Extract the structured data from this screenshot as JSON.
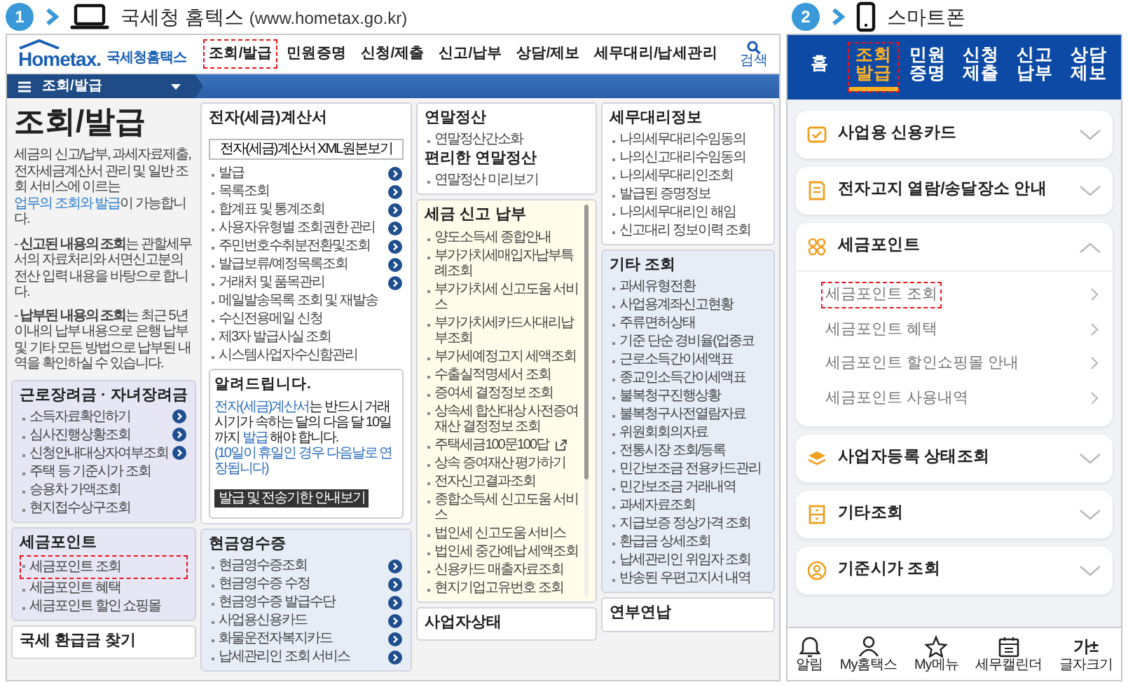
{
  "pc_header": {
    "step": "1",
    "title": "국세청 홈텍스",
    "url": "(www.hometax.go.kr)"
  },
  "mobile_header": {
    "step": "2",
    "title": "스마트폰"
  },
  "hometax": {
    "logo": {
      "wordmark": "Hometax.",
      "name": "국세청홈택스"
    },
    "menu": [
      {
        "label": "조회/발급",
        "highlighted": true
      },
      {
        "label": "민원증명",
        "highlighted": false
      },
      {
        "label": "신청/제출",
        "highlighted": false
      },
      {
        "label": "신고/납부",
        "highlighted": false
      },
      {
        "label": "상담/제보",
        "highlighted": false
      },
      {
        "label": "세무대리/납세관리",
        "highlighted": false
      }
    ],
    "search_label": "검색",
    "breadcrumb": "조회/발급",
    "intro": {
      "title": "조회/발급",
      "description": {
        "before": "세금의 신고/납부, 과세자료제출, 전자세금계산서 관리 및 일반 조회 서비스에 이르는 ",
        "link": "업무의 조회와 발급",
        "after": "이 가능합니다."
      },
      "notes": [
        "- **신고된 내용의 조회**는 관할세무서의 자료처리와 서면신고분의 전산 입력 내용을 바탕으로 합니다.",
        "- **납부된 내용의 조회**는 최근 5년 이내의 납부 내용으로 은행 납부 및 기타 모든 방법으로 납부된 내역을 확인하실 수 있습니다."
      ]
    },
    "columns": [
      {
        "panels": [
          {
            "color": "#e6e6f5",
            "scrollbar": false,
            "blocks": [
              {
                "kind": "heading",
                "text": "근로장려금 · 자녀장려금"
              },
              {
                "kind": "link",
                "text": "소득자료확인하기",
                "arrow": true,
                "highlighted": false
              },
              {
                "kind": "link",
                "text": "심사진행상황조회",
                "arrow": true,
                "highlighted": false
              },
              {
                "kind": "link",
                "text": "신청안내대상자여부조회",
                "arrow": true,
                "highlighted": false
              },
              {
                "kind": "link",
                "text": "주택 등 기준시가 조회",
                "arrow": false,
                "highlighted": false
              },
              {
                "kind": "link",
                "text": "승용차 가액조회",
                "arrow": false,
                "highlighted": false
              },
              {
                "kind": "link",
                "text": "현지접수상구조회",
                "arrow": false,
                "highlighted": false
              }
            ]
          },
          {
            "color": "#e6e6f5",
            "scrollbar": false,
            "blocks": [
              {
                "kind": "heading",
                "text": "세금포인트"
              },
              {
                "kind": "link",
                "text": "세금포인트 조회",
                "arrow": false,
                "highlighted": true
              },
              {
                "kind": "link",
                "text": "세금포인트 혜택",
                "arrow": false,
                "highlighted": false
              },
              {
                "kind": "link",
                "text": "세금포인트 할인 쇼핑몰",
                "arrow": false,
                "highlighted": false
              }
            ]
          },
          {
            "color": "#ffffff",
            "scrollbar": false,
            "blocks": [
              {
                "kind": "heading",
                "text": "국세 환급금 찾기"
              }
            ]
          }
        ]
      },
      {
        "panels": [
          {
            "color": "#ffffff",
            "scrollbar": false,
            "blocks": [
              {
                "kind": "heading",
                "text": "전자(세금)계산서"
              },
              {
                "kind": "button",
                "text": "전자(세금)계산서 XML원본보기"
              },
              {
                "kind": "link",
                "text": "발급",
                "arrow": true,
                "highlighted": false
              },
              {
                "kind": "link",
                "text": "목록조회",
                "arrow": true,
                "highlighted": false
              },
              {
                "kind": "link",
                "text": "합계표 및 통계조회",
                "arrow": true,
                "highlighted": false
              },
              {
                "kind": "link",
                "text": "사용자유형별 조회권한 관리",
                "arrow": true,
                "highlighted": false
              },
              {
                "kind": "link",
                "text": "주민번호수취분전환및조회",
                "arrow": true,
                "highlighted": false
              },
              {
                "kind": "link",
                "text": "발급보류/예정목록조회",
                "arrow": true,
                "highlighted": false
              },
              {
                "kind": "link",
                "text": "거래처 및 품목관리",
                "arrow": true,
                "highlighted": false
              },
              {
                "kind": "link",
                "text": "메일발송목록 조회 및 재발송",
                "arrow": false,
                "highlighted": false
              },
              {
                "kind": "link",
                "text": "수신전용메일 신청",
                "arrow": false,
                "highlighted": false
              },
              {
                "kind": "link",
                "text": "제3자 발급사실 조회",
                "arrow": false,
                "highlighted": false
              },
              {
                "kind": "link",
                "text": "시스템사업자수신함관리",
                "arrow": false,
                "highlighted": false
              },
              {
                "kind": "notice",
                "title": "알려드립니다.",
                "message": [
                  {
                    "text": "전자(세금)계산서",
                    "emphasis": true
                  },
                  {
                    "text": "는 반드시 거래시기가 속하는 달의 다음 달 10일까지 ",
                    "emphasis": false
                  },
                  {
                    "text": "발급",
                    "emphasis": true
                  },
                  {
                    "text": " 해야 합니다.",
                    "emphasis": false
                  }
                ],
                "remark": "(10일이 휴일인 경우 다음날로 연장됩니다)",
                "button": "발급 및 전송기한 안내보기"
              }
            ]
          },
          {
            "color": "#e6edf6",
            "scrollbar": false,
            "blocks": [
              {
                "kind": "heading",
                "text": "현금영수증"
              },
              {
                "kind": "link",
                "text": "현금영수증조회",
                "arrow": true,
                "highlighted": false
              },
              {
                "kind": "link",
                "text": "현금영수증 수정",
                "arrow": true,
                "highlighted": false
              },
              {
                "kind": "link",
                "text": "현금영수증 발급수단",
                "arrow": true,
                "highlighted": false
              },
              {
                "kind": "link",
                "text": "사업용신용카드",
                "arrow": true,
                "highlighted": false
              },
              {
                "kind": "link",
                "text": "화물운전자복지카드",
                "arrow": true,
                "highlighted": false
              },
              {
                "kind": "link",
                "text": "납세관리인 조회 서비스",
                "arrow": true,
                "highlighted": false
              }
            ]
          }
        ]
      },
      {
        "panels": [
          {
            "color": "#ffffff",
            "scrollbar": false,
            "blocks": [
              {
                "kind": "heading",
                "text": "연말정산"
              },
              {
                "kind": "link",
                "text": "연말정산간소화",
                "arrow": false,
                "highlighted": false
              },
              {
                "kind": "heading",
                "text": "편리한 연말정산"
              },
              {
                "kind": "link",
                "text": "연말정산 미리보기",
                "arrow": false,
                "highlighted": false
              }
            ]
          },
          {
            "color": "#fffdea",
            "scrollbar": true,
            "blocks": [
              {
                "kind": "heading",
                "text": "세금 신고 납부"
              },
              {
                "kind": "link",
                "text": "양도소득세 종합안내",
                "arrow": false,
                "highlighted": false
              },
              {
                "kind": "link",
                "text": "부가가치세매입자납부특례조회",
                "arrow": false,
                "highlighted": false
              },
              {
                "kind": "link",
                "text": "부가가치세 신고도움 서비스",
                "arrow": false,
                "highlighted": false
              },
              {
                "kind": "link",
                "text": "부가가치세카드사대리납부조회",
                "arrow": false,
                "highlighted": false
              },
              {
                "kind": "link",
                "text": "부가세예정고지 세액조회",
                "arrow": false,
                "highlighted": false
              },
              {
                "kind": "link",
                "text": "수출실적명세서 조회",
                "arrow": false,
                "highlighted": false
              },
              {
                "kind": "link",
                "text": "증여세 결정정보 조회",
                "arrow": false,
                "highlighted": false
              },
              {
                "kind": "link",
                "text": "상속세 합산대상 사전증여재산 결정정보 조회",
                "arrow": false,
                "highlighted": false
              },
              {
                "kind": "link",
                "text": "주택세금100문100답",
                "arrow": false,
                "highlighted": false,
                "external": true
              },
              {
                "kind": "link",
                "text": "상속 증여재산 평가하기",
                "arrow": false,
                "highlighted": false
              },
              {
                "kind": "link",
                "text": "전자신고결과조회",
                "arrow": false,
                "highlighted": false
              },
              {
                "kind": "link",
                "text": "종합소득세 신고도움 서비스",
                "arrow": false,
                "highlighted": false
              },
              {
                "kind": "link",
                "text": "법인세 신고도움 서비스",
                "arrow": false,
                "highlighted": false
              },
              {
                "kind": "link",
                "text": "법인세 중간예납 세액조회",
                "arrow": false,
                "highlighted": false
              },
              {
                "kind": "link",
                "text": "신용카드 매출자료조회",
                "arrow": false,
                "highlighted": false
              },
              {
                "kind": "link",
                "text": "현지기업고유번호 조회",
                "arrow": false,
                "highlighted": false
              }
            ]
          },
          {
            "color": "#ffffff",
            "scrollbar": false,
            "blocks": [
              {
                "kind": "heading",
                "text": "사업자상태"
              }
            ]
          }
        ]
      },
      {
        "panels": [
          {
            "color": "#ffffff",
            "scrollbar": false,
            "blocks": [
              {
                "kind": "heading",
                "text": "세무대리정보"
              },
              {
                "kind": "link",
                "text": "나의세무대리수임동의",
                "arrow": false,
                "highlighted": false
              },
              {
                "kind": "link",
                "text": "나의신고대리수임동의",
                "arrow": false,
                "highlighted": false
              },
              {
                "kind": "link",
                "text": "나의세무대리인조회",
                "arrow": false,
                "highlighted": false
              },
              {
                "kind": "link",
                "text": "발급된 증명정보",
                "arrow": false,
                "highlighted": false
              },
              {
                "kind": "link",
                "text": "나의세무대리인 해임",
                "arrow": false,
                "highlighted": false
              },
              {
                "kind": "link",
                "text": "신고대리 정보이력 조회",
                "arrow": false,
                "highlighted": false
              }
            ]
          },
          {
            "color": "#e6edf6",
            "scrollbar": false,
            "blocks": [
              {
                "kind": "heading",
                "text": "기타 조회"
              },
              {
                "kind": "link",
                "text": "과세유형전환",
                "arrow": false,
                "highlighted": false
              },
              {
                "kind": "link",
                "text": "사업용계좌신고현황",
                "arrow": false,
                "highlighted": false
              },
              {
                "kind": "link",
                "text": "주류면허상태",
                "arrow": false,
                "highlighted": false
              },
              {
                "kind": "link",
                "text": "기준 단순 경비율(업종코",
                "arrow": false,
                "highlighted": false
              },
              {
                "kind": "link",
                "text": "근로소득간이세액표",
                "arrow": false,
                "highlighted": false
              },
              {
                "kind": "link",
                "text": "종교인소득간이세액표",
                "arrow": false,
                "highlighted": false
              },
              {
                "kind": "link",
                "text": "불복청구진행상황",
                "arrow": false,
                "highlighted": false
              },
              {
                "kind": "link",
                "text": "불복청구사전열람자료",
                "arrow": false,
                "highlighted": false
              },
              {
                "kind": "link",
                "text": "위원회회의자료",
                "arrow": false,
                "highlighted": false
              },
              {
                "kind": "link",
                "text": "전통시장 조회/등록",
                "arrow": false,
                "highlighted": false
              },
              {
                "kind": "link",
                "text": "민간보조금 전용카드관리",
                "arrow": false,
                "highlighted": false
              },
              {
                "kind": "link",
                "text": "민간보조금 거래내역",
                "arrow": false,
                "highlighted": false
              },
              {
                "kind": "link",
                "text": "과세자료조회",
                "arrow": false,
                "highlighted": false
              },
              {
                "kind": "link",
                "text": "지급보증 정상가격 조회",
                "arrow": false,
                "highlighted": false
              },
              {
                "kind": "link",
                "text": "환급금 상세조회",
                "arrow": false,
                "highlighted": false
              },
              {
                "kind": "link",
                "text": "납세관리인 위임자 조회",
                "arrow": false,
                "highlighted": false
              },
              {
                "kind": "link",
                "text": "반송된 우편고지서 내역",
                "arrow": false,
                "highlighted": false
              }
            ]
          },
          {
            "color": "#ffffff",
            "scrollbar": false,
            "blocks": [
              {
                "kind": "heading",
                "text": "연부연납"
              }
            ]
          }
        ]
      }
    ]
  },
  "mobile": {
    "tabs": [
      {
        "label": "홈",
        "selected": false,
        "highlighted": false
      },
      {
        "label": "조회 발급",
        "selected": true,
        "highlighted": true
      },
      {
        "label": "민원 증명",
        "selected": false,
        "highlighted": false
      },
      {
        "label": "신청 제출",
        "selected": false,
        "highlighted": false
      },
      {
        "label": "신고 납부",
        "selected": false,
        "highlighted": false
      },
      {
        "label": "상담 제보",
        "selected": false,
        "highlighted": false
      }
    ],
    "sections": [
      {
        "title": "사업용 신용카드",
        "expanded": false
      },
      {
        "title": "전자고지 열람/송달장소 안내",
        "expanded": false
      },
      {
        "title": "세금포인트",
        "expanded": true,
        "items": [
          {
            "label": "세금포인트 조회",
            "highlighted": true
          },
          {
            "label": "세금포인트 혜택",
            "highlighted": false
          },
          {
            "label": "세금포인트 할인쇼핑몰 안내",
            "highlighted": false
          },
          {
            "label": "세금포인트 사용내역",
            "highlighted": false
          }
        ]
      },
      {
        "title": "사업자등록 상태조회",
        "expanded": false
      },
      {
        "title": "기타조회",
        "expanded": false
      },
      {
        "title": "기준시가 조회",
        "expanded": false
      }
    ],
    "bottom_nav": [
      {
        "label": "알림"
      },
      {
        "label": "My홈택스"
      },
      {
        "label": "My메뉴"
      },
      {
        "label": "세무캘린더"
      },
      {
        "label": "글자크기",
        "glyph": "가±"
      }
    ]
  }
}
